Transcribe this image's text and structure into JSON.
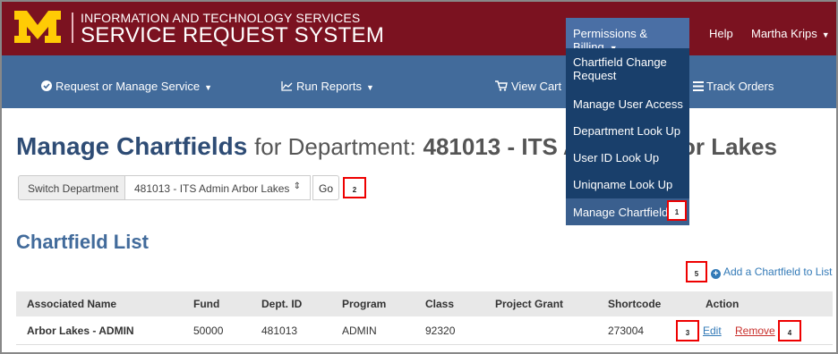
{
  "brand": {
    "line1": "INFORMATION AND TECHNOLOGY SERVICES",
    "line2": "SERVICE REQUEST SYSTEM",
    "colors": {
      "maroon": "#7b1220",
      "maize": "#ffcb05",
      "nav_blue": "#426b9b",
      "dropdown_navy": "#193f6b"
    }
  },
  "topnav": {
    "permissions_label": "Permissions & Billing",
    "help_label": "Help",
    "user_label": "Martha Krips"
  },
  "dropdown": {
    "items": [
      {
        "label": "Chartfield Change Request"
      },
      {
        "label": "Manage User Access"
      },
      {
        "label": "Department Look Up"
      },
      {
        "label": "User ID Look Up"
      },
      {
        "label": "Uniqname Look Up"
      },
      {
        "label": "Manage Chartfields"
      }
    ]
  },
  "mainnav": {
    "request_label": "Request or Manage Service",
    "reports_label": "Run Reports",
    "cart_label": "View Cart",
    "orders_label": "Track Orders"
  },
  "page": {
    "title": "Manage Chartfields",
    "title_for": "for Department:",
    "department": "481013 - ITS Admin Arbor Lakes"
  },
  "switch": {
    "label": "Switch Department",
    "selected": "481013 - ITS Admin Arbor Lakes",
    "go_label": "Go"
  },
  "list": {
    "title": "Chartfield List",
    "add_label": "Add a Chartfield to List",
    "columns": [
      "Associated Name",
      "Fund",
      "Dept. ID",
      "Program",
      "Class",
      "Project Grant",
      "Shortcode",
      "Action"
    ],
    "rows": [
      {
        "name": "Arbor Lakes - ADMIN",
        "fund": "50000",
        "dept_id": "481013",
        "program": "ADMIN",
        "class": "92320",
        "project_grant": "",
        "shortcode": "273004",
        "edit": "Edit",
        "remove": "Remove"
      }
    ]
  },
  "callouts": [
    "1",
    "2",
    "3",
    "4",
    "5"
  ]
}
